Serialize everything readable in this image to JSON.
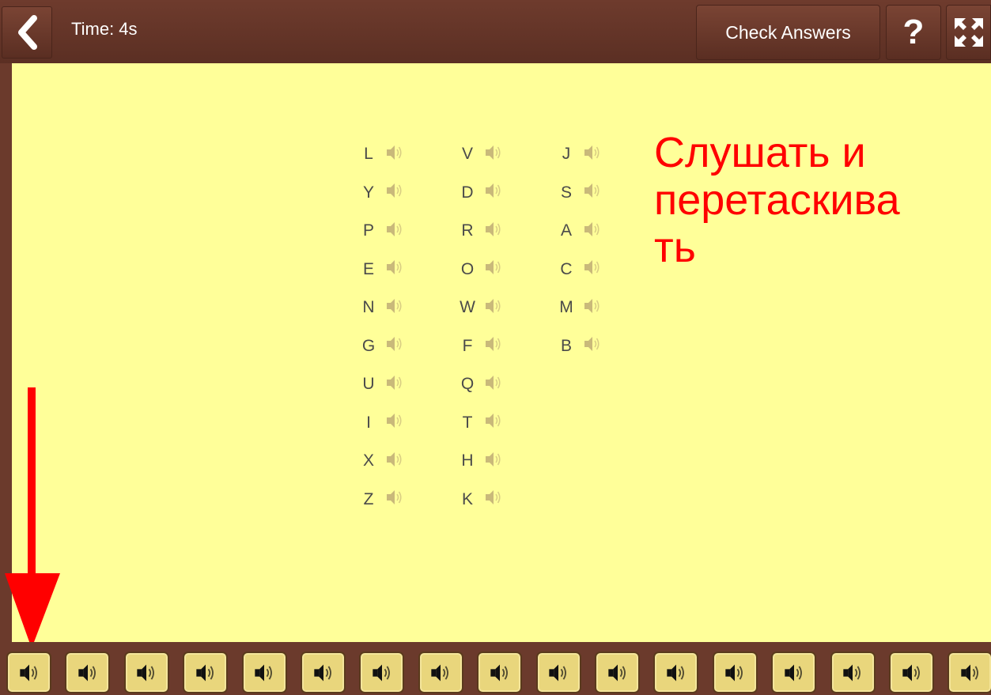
{
  "header": {
    "timer_text": "Time: 4s",
    "check_answers_label": "Check Answers",
    "help_label": "?"
  },
  "columns": [
    [
      "L",
      "Y",
      "P",
      "E",
      "N",
      "G",
      "U",
      "I",
      "X",
      "Z"
    ],
    [
      "V",
      "D",
      "R",
      "O",
      "W",
      "F",
      "Q",
      "T",
      "H",
      "K"
    ],
    [
      "J",
      "S",
      "A",
      "C",
      "M",
      "B"
    ]
  ],
  "instruction": "Слушать и\nперетаскива\nть",
  "tray": {
    "tile_count": 17,
    "icon": "speaker-icon"
  },
  "colors": {
    "frame": "#6b3a2c",
    "panel": "#ffff99",
    "annotation": "#ff0000",
    "tile": "#e9d67c"
  }
}
